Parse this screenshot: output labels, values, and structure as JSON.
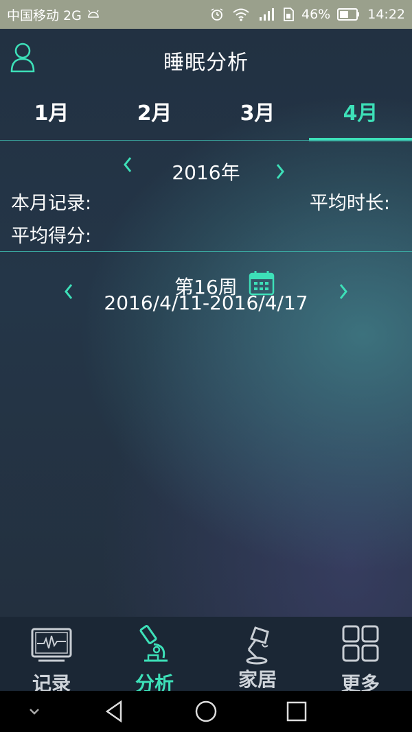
{
  "status_bar": {
    "carrier": "中国移动 2G",
    "battery": "46%",
    "time": "14:22"
  },
  "header": {
    "title": "睡眠分析"
  },
  "tabs": [
    {
      "label": "1月",
      "active": false
    },
    {
      "label": "2月",
      "active": false
    },
    {
      "label": "3月",
      "active": false
    },
    {
      "label": "4月",
      "active": true
    }
  ],
  "year_selector": {
    "year": "2016年"
  },
  "stats": {
    "month_records_label": "本月记录:",
    "avg_duration_label": "平均时长:",
    "avg_score_label": "平均得分:"
  },
  "week_selector": {
    "week_label": "第16周",
    "date_range": "2016/4/11-2016/4/17"
  },
  "bottom_nav": [
    {
      "label": "记录",
      "icon": "monitor-icon",
      "active": false
    },
    {
      "label": "分析",
      "icon": "microscope-icon",
      "active": true
    },
    {
      "label": "家居",
      "icon": "lamp-icon",
      "active": false
    },
    {
      "label": "更多",
      "icon": "grid-icon",
      "active": false
    }
  ],
  "colors": {
    "accent": "#3de0b8",
    "status_bar": "#9aa08c",
    "nav_background": "#1b2735"
  }
}
